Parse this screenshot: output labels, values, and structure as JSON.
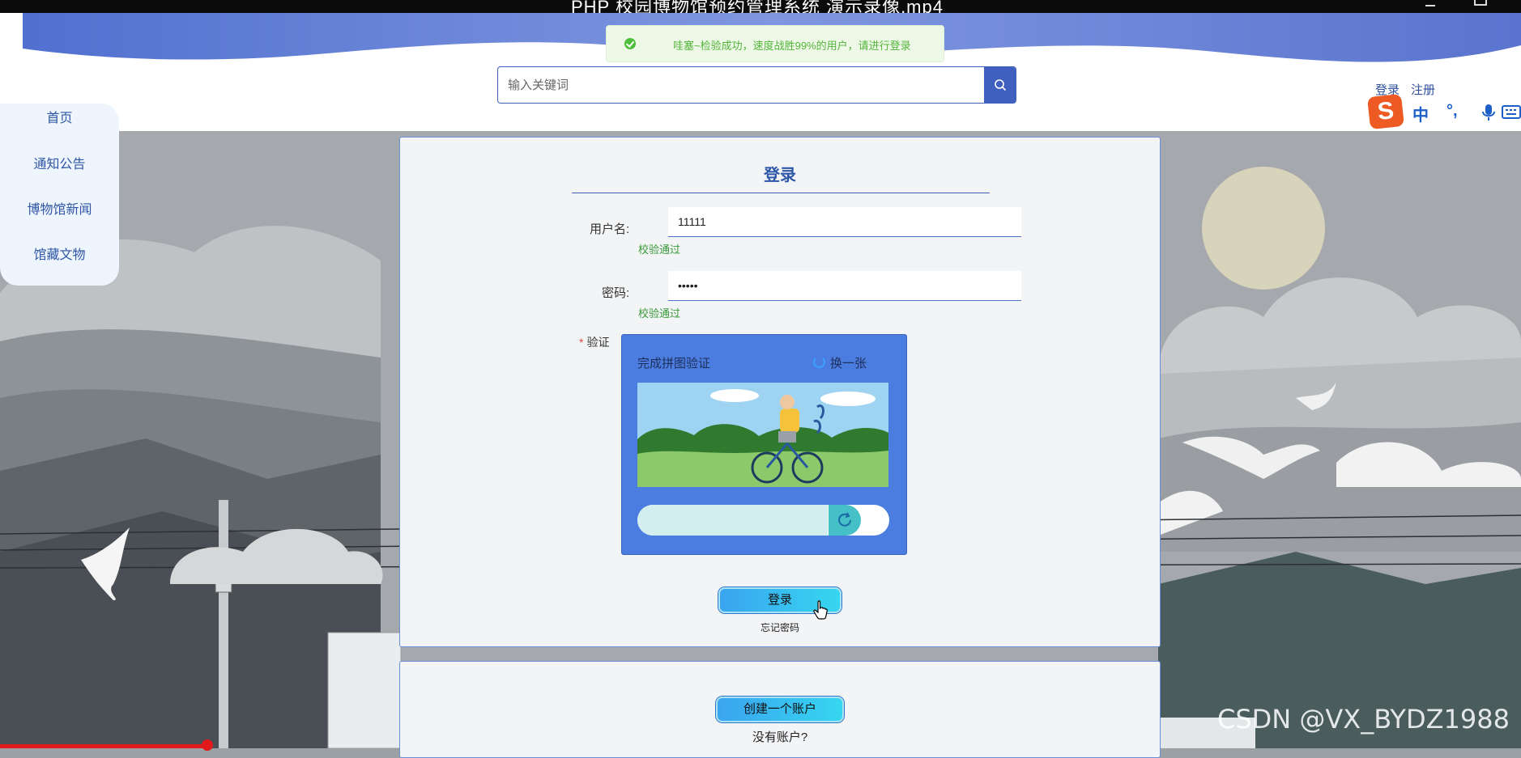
{
  "video": {
    "title": "PHP 校园博物馆预约管理系统 演示录像.mp4"
  },
  "toast": {
    "message": "哇塞~检验成功，速度战胜99%的用户，请进行登录"
  },
  "search": {
    "placeholder": "输入关键词"
  },
  "header_links": {
    "login": "登录",
    "register": "注册"
  },
  "ime": {
    "logo": "S",
    "mode": "中",
    "punct": "°,"
  },
  "nav": {
    "items": [
      {
        "label": "首页"
      },
      {
        "label": "通知公告"
      },
      {
        "label": "博物馆新闻"
      },
      {
        "label": "馆藏文物"
      }
    ]
  },
  "login": {
    "title": "登录",
    "username_label": "用户名:",
    "username_value": "11111",
    "username_status": "校验通过",
    "password_label": "密码:",
    "password_value": "•••••",
    "password_status": "校验通过",
    "captcha_label": "验证",
    "captcha_required_mark": "*",
    "captcha_title": "完成拼图验证",
    "captcha_refresh": "换一张",
    "submit_label": "登录",
    "forgot_label": "忘记密码"
  },
  "register": {
    "create_label": "创建一个账户",
    "no_account": "没有账户?"
  },
  "watermark": "CSDN @VX_BYDZ1988",
  "colors": {
    "accent": "#4060c0",
    "success": "#3a9a3a",
    "captcha_bg": "#4b7de0"
  }
}
